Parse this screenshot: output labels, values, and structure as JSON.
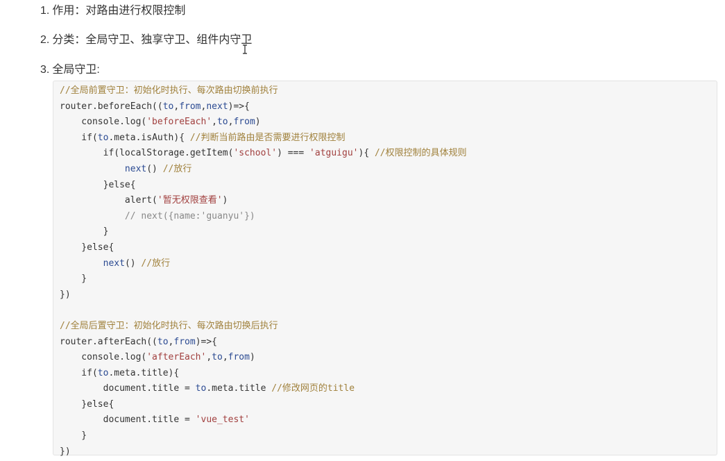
{
  "list": [
    {
      "num": "1.",
      "text": "作用：对路由进行权限控制"
    },
    {
      "num": "2.",
      "text": "分类：全局守卫、独享守卫、组件内守卫"
    },
    {
      "num": "3.",
      "text": "全局守卫:"
    }
  ],
  "code": {
    "lines": [
      [
        {
          "t": "//全局前置守卫：初始化时执行、每次路由切换前执行",
          "c": "cm"
        }
      ],
      [
        {
          "t": "router.beforeEach((",
          "c": "kw"
        },
        {
          "t": "to",
          "c": "var"
        },
        {
          "t": ",",
          "c": "kw"
        },
        {
          "t": "from",
          "c": "var"
        },
        {
          "t": ",",
          "c": "kw"
        },
        {
          "t": "next",
          "c": "var"
        },
        {
          "t": ")=>{",
          "c": "kw"
        }
      ],
      [
        {
          "t": "    console.log(",
          "c": "kw"
        },
        {
          "t": "'beforeEach'",
          "c": "str"
        },
        {
          "t": ",",
          "c": "kw"
        },
        {
          "t": "to",
          "c": "var"
        },
        {
          "t": ",",
          "c": "kw"
        },
        {
          "t": "from",
          "c": "var"
        },
        {
          "t": ")",
          "c": "kw"
        }
      ],
      [
        {
          "t": "    if(",
          "c": "kw"
        },
        {
          "t": "to",
          "c": "var"
        },
        {
          "t": ".meta.isAuth){ ",
          "c": "kw"
        },
        {
          "t": "//判断当前路由是否需要进行权限控制",
          "c": "cm"
        }
      ],
      [
        {
          "t": "        if(localStorage.getItem(",
          "c": "kw"
        },
        {
          "t": "'school'",
          "c": "str"
        },
        {
          "t": ") === ",
          "c": "kw"
        },
        {
          "t": "'atguigu'",
          "c": "str"
        },
        {
          "t": "){ ",
          "c": "kw"
        },
        {
          "t": "//权限控制的具体规则",
          "c": "cm"
        }
      ],
      [
        {
          "t": "            ",
          "c": "kw"
        },
        {
          "t": "next",
          "c": "var"
        },
        {
          "t": "() ",
          "c": "kw"
        },
        {
          "t": "//放行",
          "c": "cm"
        }
      ],
      [
        {
          "t": "        }else{",
          "c": "kw"
        }
      ],
      [
        {
          "t": "            alert(",
          "c": "kw"
        },
        {
          "t": "'暂无权限查看'",
          "c": "str"
        },
        {
          "t": ")",
          "c": "kw"
        }
      ],
      [
        {
          "t": "            // next({name:'guanyu'})",
          "c": "ci"
        }
      ],
      [
        {
          "t": "        }",
          "c": "kw"
        }
      ],
      [
        {
          "t": "    }else{",
          "c": "kw"
        }
      ],
      [
        {
          "t": "        ",
          "c": "kw"
        },
        {
          "t": "next",
          "c": "var"
        },
        {
          "t": "() ",
          "c": "kw"
        },
        {
          "t": "//放行",
          "c": "cm"
        }
      ],
      [
        {
          "t": "    }",
          "c": "kw"
        }
      ],
      [
        {
          "t": "})",
          "c": "kw"
        }
      ],
      [
        {
          "t": "",
          "c": "kw"
        }
      ],
      [
        {
          "t": "//全局后置守卫：初始化时执行、每次路由切换后执行",
          "c": "cm"
        }
      ],
      [
        {
          "t": "router.afterEach((",
          "c": "kw"
        },
        {
          "t": "to",
          "c": "var"
        },
        {
          "t": ",",
          "c": "kw"
        },
        {
          "t": "from",
          "c": "var"
        },
        {
          "t": ")=>{",
          "c": "kw"
        }
      ],
      [
        {
          "t": "    console.log(",
          "c": "kw"
        },
        {
          "t": "'afterEach'",
          "c": "str"
        },
        {
          "t": ",",
          "c": "kw"
        },
        {
          "t": "to",
          "c": "var"
        },
        {
          "t": ",",
          "c": "kw"
        },
        {
          "t": "from",
          "c": "var"
        },
        {
          "t": ")",
          "c": "kw"
        }
      ],
      [
        {
          "t": "    if(",
          "c": "kw"
        },
        {
          "t": "to",
          "c": "var"
        },
        {
          "t": ".meta.title){",
          "c": "kw"
        }
      ],
      [
        {
          "t": "        document.title = ",
          "c": "kw"
        },
        {
          "t": "to",
          "c": "var"
        },
        {
          "t": ".meta.title ",
          "c": "kw"
        },
        {
          "t": "//修改网页的title",
          "c": "cm"
        }
      ],
      [
        {
          "t": "    }else{",
          "c": "kw"
        }
      ],
      [
        {
          "t": "        document.title = ",
          "c": "kw"
        },
        {
          "t": "'vue_test'",
          "c": "str"
        }
      ],
      [
        {
          "t": "    }",
          "c": "kw"
        }
      ],
      [
        {
          "t": "})",
          "c": "kw"
        }
      ]
    ]
  },
  "colors": {
    "comment": "#a0813c",
    "variable": "#2b4a92",
    "string": "#a1403f",
    "text": "#333333",
    "code_background": "#f6f6f6"
  },
  "icons": {
    "cursor": "text-cursor-icon"
  }
}
